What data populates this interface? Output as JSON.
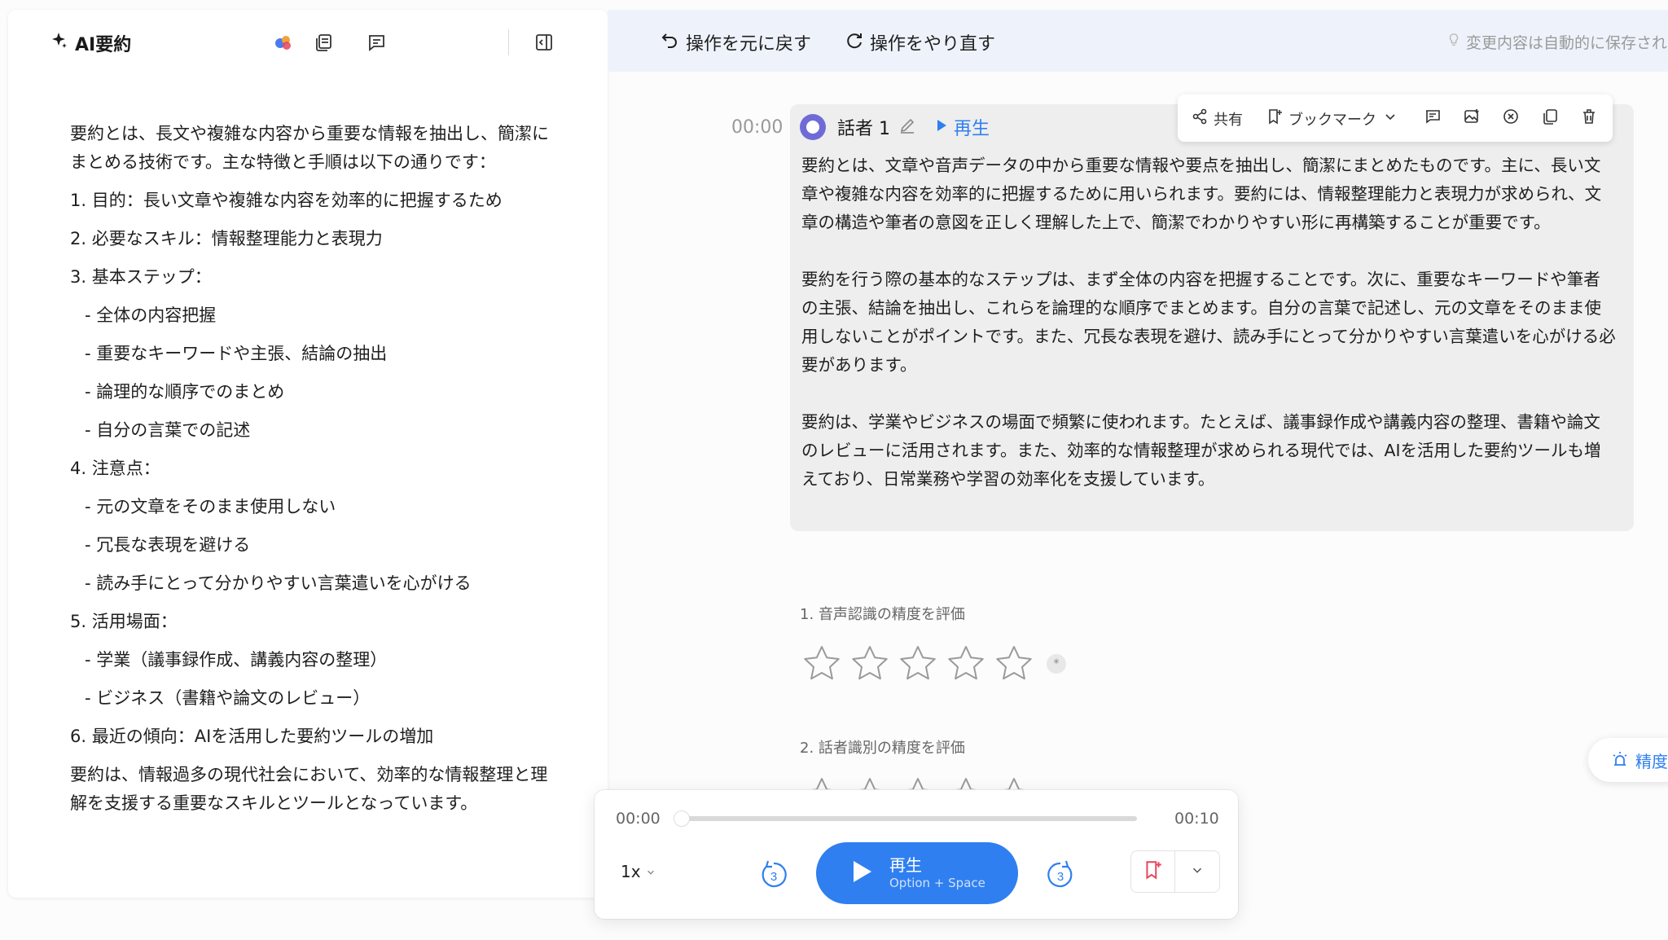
{
  "left_panel": {
    "title": "AI要約",
    "summary": {
      "intro": "要約とは、長文や複雑な内容から重要な情報を抽出し、簡潔にまとめる技術です。主な特徴と手順は以下の通りです：",
      "items": [
        "1. 目的：長い文章や複雑な内容を効率的に把握するため",
        "2. 必要なスキル：情報整理能力と表現力",
        "3. 基本ステップ：",
        "- 全体の内容把握",
        "- 重要なキーワードや主張、結論の抽出",
        "- 論理的な順序でのまとめ",
        "- 自分の言葉での記述",
        "4. 注意点：",
        "- 元の文章をそのまま使用しない",
        "- 冗長な表現を避ける",
        "- 読み手にとって分かりやすい言葉遣いを心がける",
        "5. 活用場面：",
        "- 学業（議事録作成、講義内容の整理）",
        "- ビジネス（書籍や論文のレビュー）",
        "6. 最近の傾向：AIを活用した要約ツールの増加"
      ],
      "outro": "要約は、情報過多の現代社会において、効率的な情報整理と理解を支援する重要なスキルとツールとなっています。"
    }
  },
  "topbar": {
    "undo_label": "操作を元に戻す",
    "redo_label": "操作をやり直す",
    "autosave_text": "変更内容は自動的に保存され"
  },
  "transcript": {
    "timestamp": "00:00",
    "speaker": "話者 1",
    "play_label": "再生",
    "paragraphs": [
      "要約とは、文章や音声データの中から重要な情報や要点を抽出し、簡潔にまとめたものです。主に、長い文章や複雑な内容を効率的に把握するために用いられます。要約には、情報整理能力と表現力が求められ、文章の構造や筆者の意図を正しく理解した上で、簡潔でわかりやすい形に再構築することが重要です。",
      "要約を行う際の基本的なステップは、まず全体の内容を把握することです。次に、重要なキーワードや筆者の主張、結論を抽出し、これらを論理的な順序でまとめます。自分の言葉で記述し、元の文章をそのまま使用しないことがポイントです。また、冗長な表現を避け、読み手にとって分かりやすい言葉遣いを心がける必要があります。",
      "要約は、学業やビジネスの場面で頻繁に使われます。たとえば、議事録作成や講義内容の整理、書籍や論文のレビューに活用されます。また、効率的な情報整理が求められる現代では、AIを活用した要約ツールも増えており、日常業務や学習の効率化を支援しています。"
    ]
  },
  "toolbar": {
    "share_label": "共有",
    "bookmark_label": "ブックマーク"
  },
  "ratings": {
    "q1_label": "1. 音声認識の精度を評価",
    "q2_label": "2. 話者識別の精度を評価",
    "q1_value": 0,
    "note_symbol": "*"
  },
  "accuracy_button": {
    "label": "精度"
  },
  "player": {
    "current_time": "00:00",
    "total_time": "00:10",
    "speed": "1x",
    "skip_seconds": "3",
    "play_label": "再生",
    "shortcut": "Option + Space",
    "progress": 0
  },
  "colors": {
    "accent": "#2f7ff0",
    "bookmark": "#e8435a"
  }
}
